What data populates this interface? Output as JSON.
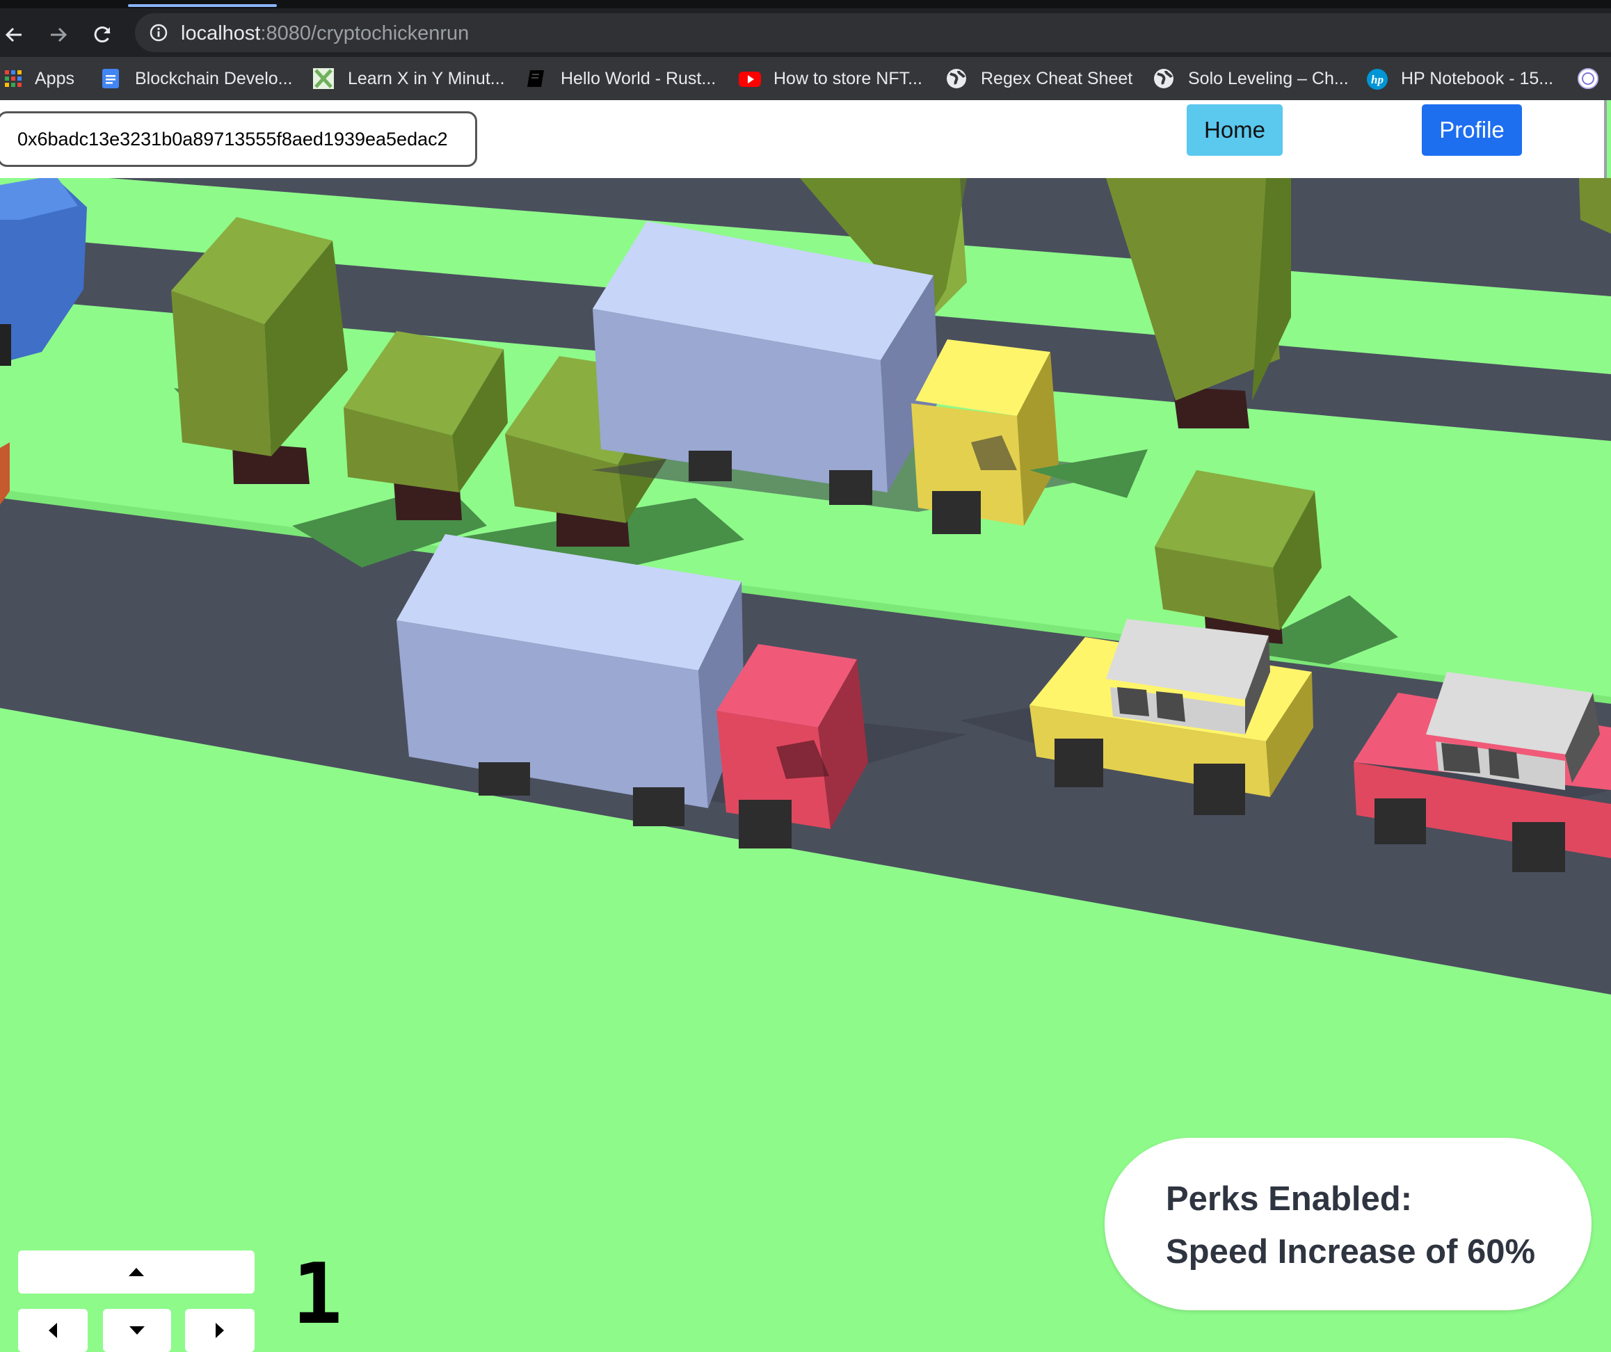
{
  "browser": {
    "url_host": "localhost",
    "url_rest": ":8080/cryptochickenrun",
    "bookmarks": [
      {
        "label": "Apps",
        "icon": "apps-grid-icon"
      },
      {
        "label": "Blockchain Develo...",
        "icon": "google-docs-icon"
      },
      {
        "label": "Learn X in Y Minut...",
        "icon": "learnxiny-icon"
      },
      {
        "label": "Hello World - Rust...",
        "icon": "rust-book-icon"
      },
      {
        "label": "How to store NFT...",
        "icon": "youtube-icon"
      },
      {
        "label": "Regex Cheat Sheet",
        "icon": "globe-icon"
      },
      {
        "label": "Solo Leveling – Ch...",
        "icon": "globe-icon"
      },
      {
        "label": "HP Notebook - 15...",
        "icon": "hp-logo-icon"
      }
    ],
    "colors": {
      "accent": "#8ab4f8"
    }
  },
  "header": {
    "wallet_address": "0x6badc13e3231b0a89713555f8aed1939ea5edac2",
    "home_label": "Home",
    "profile_label": "Profile",
    "colors": {
      "home": "#5bc8ee",
      "profile": "#1e6ff0"
    }
  },
  "game": {
    "score": "1",
    "perks_line1": "Perks Enabled:",
    "perks_line2": "Speed Increase of 60%",
    "colors": {
      "grass": "#8efa8a",
      "road": "#4a4f5c",
      "tree": "#7d9a35",
      "truck": "#b5c2ec",
      "red": "#e44a65",
      "yellow": "#f3e35a"
    },
    "controls": [
      "arrow-up",
      "arrow-left",
      "arrow-down",
      "arrow-right"
    ]
  }
}
